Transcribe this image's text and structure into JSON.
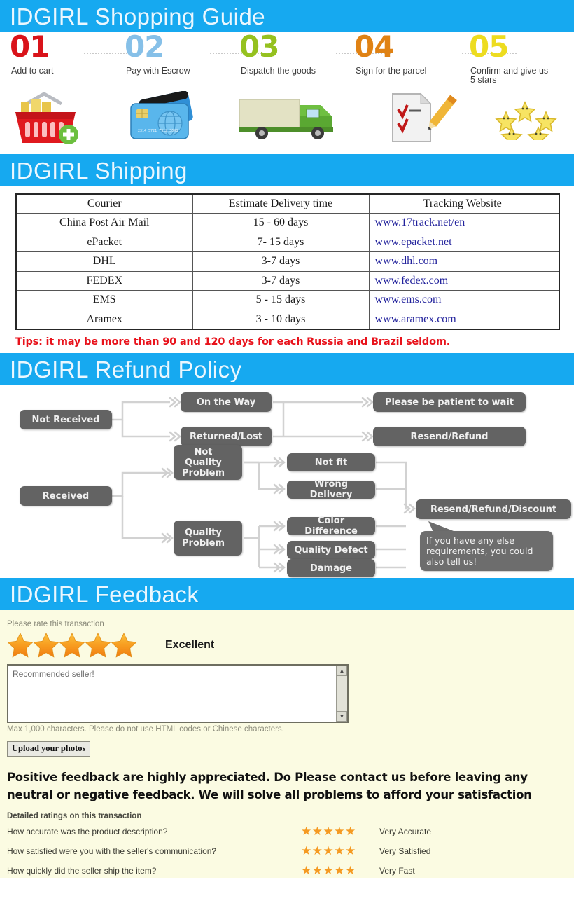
{
  "sections": {
    "guide_title": "IDGIRL Shopping Guide",
    "shipping_title": "IDGIRL Shipping",
    "refund_title": "IDGIRL Refund Policy",
    "feedback_title": "IDGIRL Feedback"
  },
  "guide": {
    "steps": [
      {
        "num": "01",
        "label": "Add to cart",
        "color": "#d9131a",
        "icon": "shopping-basket-icon"
      },
      {
        "num": "02",
        "label": "Pay with Escrow",
        "color": "#86c0e8",
        "icon": "credit-card-icon"
      },
      {
        "num": "03",
        "label": "Dispatch the goods",
        "color": "#95c11f",
        "icon": "delivery-truck-icon"
      },
      {
        "num": "04",
        "label": "Sign for the parcel",
        "color": "#e08214",
        "icon": "signed-document-icon"
      },
      {
        "num": "05",
        "label": "Confirm and give us 5 stars",
        "color": "#eddc20",
        "icon": "five-stars-icon"
      }
    ]
  },
  "shipping": {
    "headers": [
      "Courier",
      "Estimate Delivery time",
      "Tracking Website"
    ],
    "rows": [
      {
        "courier": "China Post Air Mail",
        "time": "15 - 60 days",
        "site": "www.17track.net/en"
      },
      {
        "courier": "ePacket",
        "time": "7- 15 days",
        "site": "www.epacket.net"
      },
      {
        "courier": "DHL",
        "time": "3-7 days",
        "site": "www.dhl.com"
      },
      {
        "courier": "FEDEX",
        "time": "3-7 days",
        "site": "www.fedex.com"
      },
      {
        "courier": "EMS",
        "time": "5 - 15 days",
        "site": "www.ems.com"
      },
      {
        "courier": "Aramex",
        "time": "3 - 10 days",
        "site": "www.aramex.com"
      }
    ],
    "tips": "Tips: it may be more than 90 and 120 days for each Russia and Brazil seldom.",
    "link_color": "#22229c",
    "tips_color": "#e8121b"
  },
  "refund": {
    "nodes": {
      "not_received": "Not Received",
      "on_the_way": "On the Way",
      "returned_lost": "Returned/Lost",
      "please_wait": "Please be patient to wait",
      "resend_refund": "Resend/Refund",
      "received": "Received",
      "not_quality_problem": "Not\nQuality\nProblem",
      "quality_problem": "Quality\nProblem",
      "not_fit": "Not fit",
      "wrong_delivery": "Wrong Delivery",
      "color_difference": "Color Difference",
      "quality_defect": "Quality Defect",
      "damage": "Damage",
      "resend_refund_discount": "Resend/Refund/Discount",
      "bubble": "If you have any else requirements, you could also tell us!"
    },
    "node_color": "#636363"
  },
  "feedback": {
    "rate_prompt": "Please rate this transaction",
    "rating_label": "Excellent",
    "star_count": 5,
    "comment_value": "Recommended seller!",
    "max_chars_note": "Max 1,000 characters. Please do not use HTML codes or Chinese characters.",
    "upload_button": "Upload your photos",
    "bold_note": "Positive feedback are highly appreciated. Do Please contact us before leaving any neutral or negative feedback. We will solve all problems to afford your satisfaction",
    "detailed_title": "Detailed ratings on this transaction",
    "detailed_rows": [
      {
        "question": "How accurate was the product description?",
        "stars": "★★★★★",
        "value": "Very Accurate"
      },
      {
        "question": "How satisfied were you with the seller's communication?",
        "stars": "★★★★★",
        "value": "Very Satisfied"
      },
      {
        "question": "How quickly did the seller ship the item?",
        "stars": "★★★★★",
        "value": "Very Fast"
      }
    ],
    "background_color": "#fbfbe2",
    "star_color": "#f59a22"
  },
  "theme": {
    "banner_blue": "#16a9f0",
    "banner_text": "#eaf7ff"
  }
}
